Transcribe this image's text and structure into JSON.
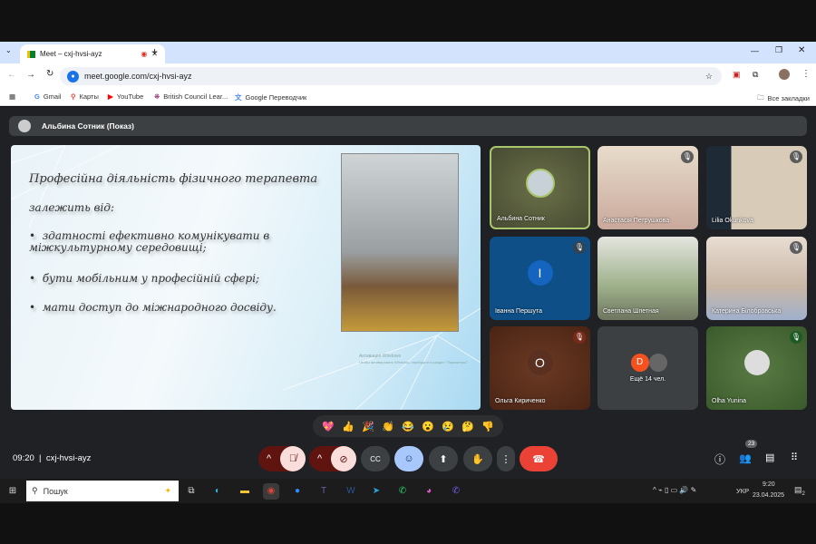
{
  "browser": {
    "tab_title": "Meet – cxj-hvsi-ayz",
    "url": "meet.google.com/cxj-hvsi-ayz",
    "bookmarks": [
      "Gmail",
      "Карты",
      "YouTube",
      "British Council Lear...",
      "Google Переводчик"
    ],
    "all_bookmarks": "Все закладки"
  },
  "presenter": "Альбина Сотник (Показ)",
  "slide": {
    "title": "Професійна діяльність фізичного терапевта",
    "subtitle": "залежить від:",
    "bullets": [
      "здатності ефективно комунікувати в міжкультурному середовищі;",
      "бути мобільним у професійній сфері;",
      "мати доступ до міжнародного досвіду."
    ],
    "watermark": "Активация Windows",
    "watermark_sub": "Чтобы активировать Windows, перейдите в раздел \"Параметры\"."
  },
  "participants": [
    {
      "name": "Альбина Сотник",
      "type": "avatar-photo"
    },
    {
      "name": "Анастасія Петрушкова",
      "type": "video"
    },
    {
      "name": "Lilia Okunkova",
      "type": "video"
    },
    {
      "name": "Іванна Першута",
      "type": "letter",
      "letter": "І"
    },
    {
      "name": "Светлана Шпетная",
      "type": "video"
    },
    {
      "name": "Катерина Білобровська",
      "type": "video"
    },
    {
      "name": "Ольга Кириченко",
      "type": "letter",
      "letter": "О"
    },
    {
      "name": "Ещё 14 чел.",
      "type": "more",
      "letter": "D"
    },
    {
      "name": "Olha Yunina",
      "type": "avatar-photo"
    }
  ],
  "reactions": [
    "💖",
    "👍",
    "🎉",
    "👏",
    "😂",
    "😮",
    "😢",
    "🤔",
    "👎"
  ],
  "footer": {
    "time": "09:20",
    "meeting_code": "cxj-hvsi-ayz",
    "participant_count": "23"
  },
  "taskbar": {
    "search": "Пошук",
    "lang": "УКР",
    "clock": "9:20",
    "date": "23.04.2025",
    "notif": "2"
  },
  "colors": {
    "accent": "#8ab4f8",
    "end_call": "#ea4335",
    "muted": "#f9dedc"
  }
}
